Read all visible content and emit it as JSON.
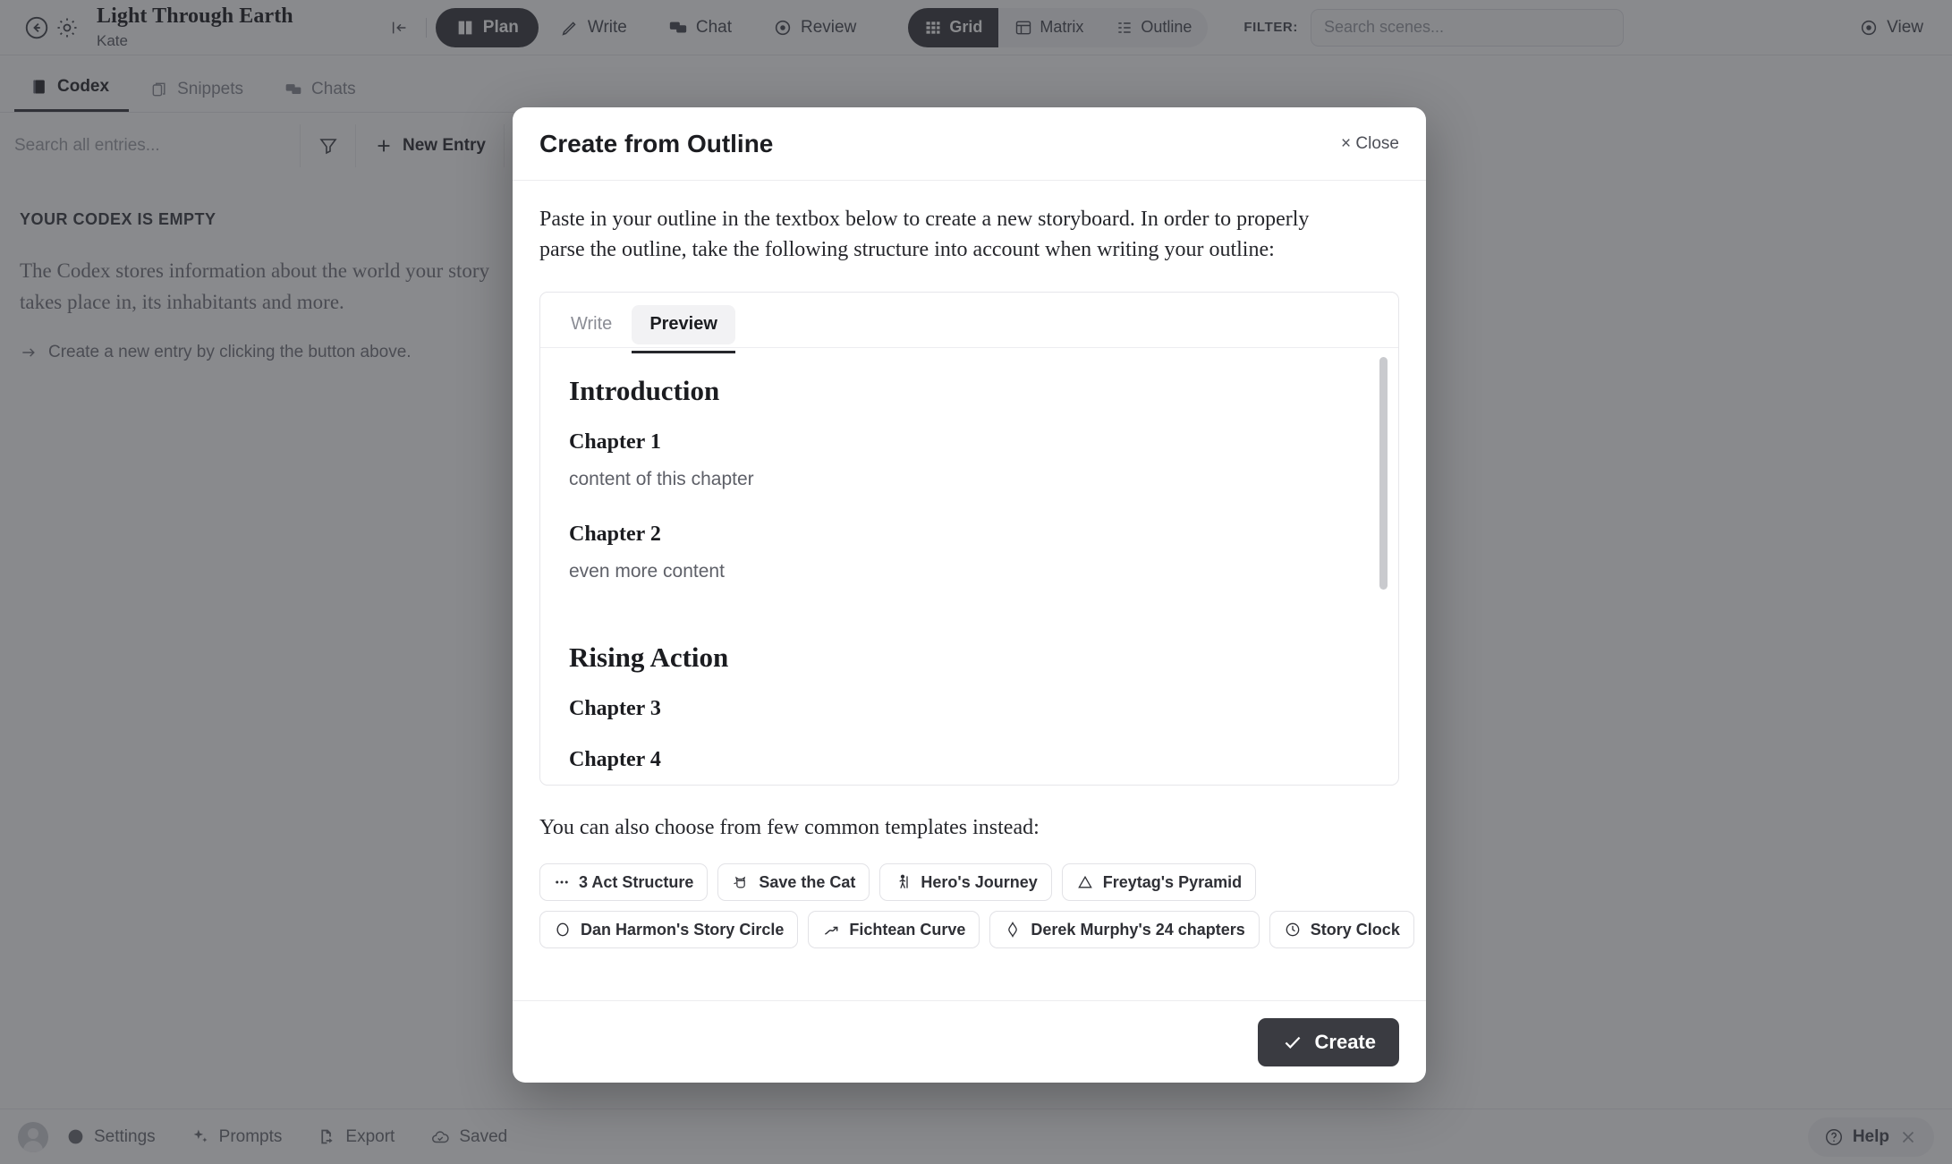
{
  "app": {
    "topbar": {
      "back_icon": "arrow-left-circle-icon",
      "settings_icon": "gear-icon",
      "project_title": "Light Through Earth",
      "project_author": "Kate",
      "collapse_icon": "collapse-left-icon",
      "modes": [
        {
          "label": "Plan",
          "icon": "book-icon",
          "active": true
        },
        {
          "label": "Write",
          "icon": "pencil-icon",
          "active": false
        },
        {
          "label": "Chat",
          "icon": "chat-bubbles-icon",
          "active": false
        },
        {
          "label": "Review",
          "icon": "target-icon",
          "active": false
        }
      ],
      "views": [
        {
          "label": "Grid",
          "icon": "grid-icon",
          "active": true
        },
        {
          "label": "Matrix",
          "icon": "matrix-icon",
          "active": false
        },
        {
          "label": "Outline",
          "icon": "outline-icon",
          "active": false
        }
      ],
      "filter_label": "FILTER:",
      "filter_placeholder": "Search scenes...",
      "view_button": {
        "label": "View",
        "icon": "eye-icon"
      }
    },
    "subtabs": [
      {
        "label": "Codex",
        "icon": "book-closed-icon",
        "active": true
      },
      {
        "label": "Snippets",
        "icon": "snippets-icon",
        "active": false
      },
      {
        "label": "Chats",
        "icon": "chat-bubbles-icon",
        "active": false
      }
    ],
    "toolbar": {
      "search_placeholder": "Search all entries...",
      "filter_icon": "funnel-icon",
      "new_entry_label": "New Entry",
      "new_entry_icon": "plus-icon",
      "settings_icon": "gear-icon"
    },
    "empty_state": {
      "heading": "YOUR CODEX IS EMPTY",
      "body": "The Codex stores information about the world your story takes place in, its inhabitants and more.",
      "hint": "Create a new entry by clicking the button above.",
      "hint_icon": "arrow-right-icon"
    },
    "bottombar": {
      "avatar_icon": "avatar-icon",
      "items": [
        {
          "label": "Settings",
          "icon": "gear-icon"
        },
        {
          "label": "Prompts",
          "icon": "sparkles-icon"
        },
        {
          "label": "Export",
          "icon": "export-file-icon"
        },
        {
          "label": "Saved",
          "icon": "cloud-check-icon"
        }
      ],
      "help": {
        "label": "Help",
        "icon": "question-circle-icon",
        "close_icon": "close-icon"
      }
    }
  },
  "modal": {
    "title": "Create from Outline",
    "close_label": "× Close",
    "intro": "Paste in your outline in the textbox below to create a new storyboard. In order to properly parse the outline, take the following structure into account when writing your outline:",
    "editor_tabs": [
      {
        "label": "Write",
        "active": false
      },
      {
        "label": "Preview",
        "active": true
      }
    ],
    "preview": {
      "blocks": [
        {
          "type": "h1",
          "text": "Introduction"
        },
        {
          "type": "h2",
          "text": "Chapter 1"
        },
        {
          "type": "p",
          "text": "content of this chapter"
        },
        {
          "type": "h2",
          "text": "Chapter 2"
        },
        {
          "type": "p",
          "text": "even more content"
        },
        {
          "type": "h1",
          "text": "Rising Action"
        },
        {
          "type": "h2",
          "text": "Chapter 3"
        },
        {
          "type": "h2",
          "text": "Chapter 4"
        }
      ]
    },
    "templates_label": "You can also choose from few common templates instead:",
    "templates": [
      {
        "label": "3 Act Structure",
        "icon": "three-dots-icon"
      },
      {
        "label": "Save the Cat",
        "icon": "cat-icon"
      },
      {
        "label": "Hero's Journey",
        "icon": "hiker-icon"
      },
      {
        "label": "Freytag's Pyramid",
        "icon": "triangle-icon"
      },
      {
        "label": "Dan Harmon's Story Circle",
        "icon": "circle-icon"
      },
      {
        "label": "Fichtean Curve",
        "icon": "trend-up-icon"
      },
      {
        "label": "Derek Murphy's 24 chapters",
        "icon": "diamond-icon"
      },
      {
        "label": "Story Clock",
        "icon": "clock-icon"
      }
    ],
    "create_button": {
      "label": "Create",
      "icon": "check-icon"
    }
  },
  "colors": {
    "accent_dark": "#3a3b41",
    "overlay": "rgba(40,41,47,0.55)",
    "text_primary": "#1c1d21",
    "text_muted": "#8b8d95"
  }
}
